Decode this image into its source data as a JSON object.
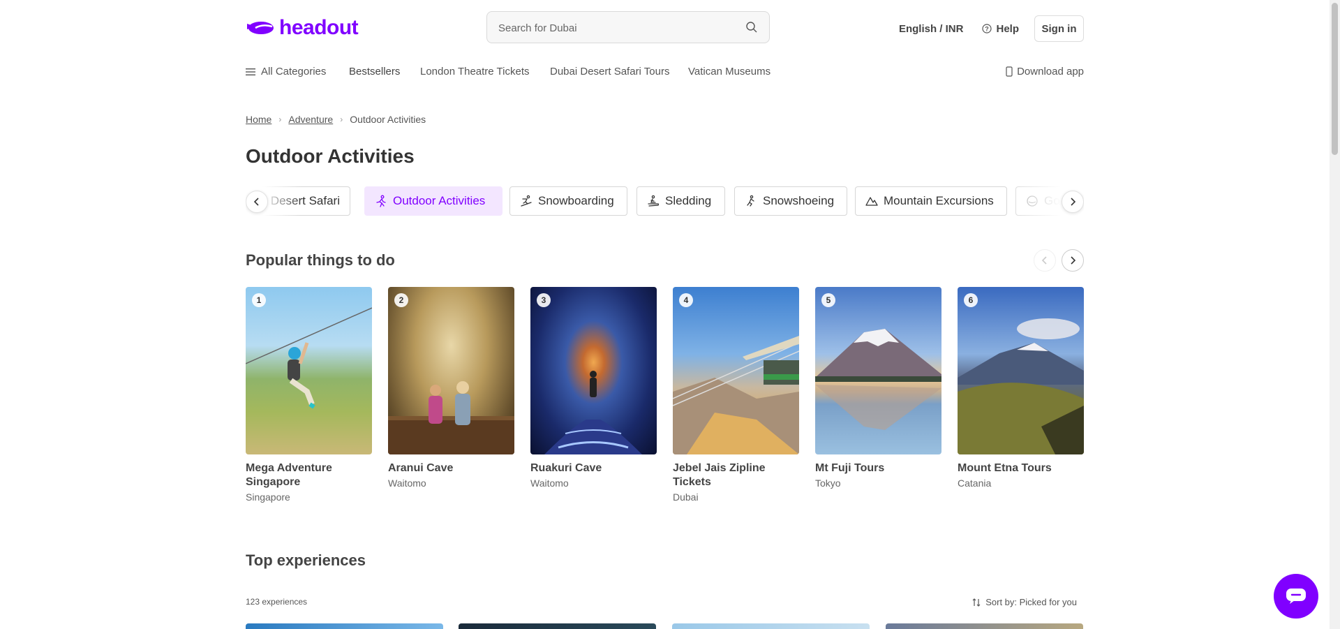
{
  "header": {
    "logo_text": "headout",
    "search_placeholder": "Search for Dubai",
    "language_currency": "English / INR",
    "help_label": "Help",
    "signin_label": "Sign in"
  },
  "nav": {
    "all_categories": "All Categories",
    "items": [
      "Bestsellers",
      "London Theatre Tickets",
      "Dubai Desert Safari Tours",
      "Vatican Museums"
    ],
    "download_app": "Download app"
  },
  "breadcrumb": [
    "Home",
    "Adventure",
    "Outdoor Activities"
  ],
  "page_title": "Outdoor Activities",
  "categories": [
    {
      "label": "Desert Safari",
      "icon": "desert-icon",
      "state": "partial"
    },
    {
      "label": "Outdoor Activities",
      "icon": "hiking-icon",
      "state": "active"
    },
    {
      "label": "Snowboarding",
      "icon": "snowboarding-icon",
      "state": "normal"
    },
    {
      "label": "Sledding",
      "icon": "sledding-icon",
      "state": "normal"
    },
    {
      "label": "Snowshoeing",
      "icon": "snowshoeing-icon",
      "state": "normal"
    },
    {
      "label": "Mountain Excursions",
      "icon": "mountain-icon",
      "state": "normal"
    },
    {
      "label": "Go",
      "icon": "golf-icon",
      "state": "partial"
    }
  ],
  "popular": {
    "title": "Popular things to do",
    "items": [
      {
        "rank": "1",
        "name": "Mega Adventure Singapore",
        "city": "Singapore"
      },
      {
        "rank": "2",
        "name": "Aranui Cave",
        "city": "Waitomo"
      },
      {
        "rank": "3",
        "name": "Ruakuri Cave",
        "city": "Waitomo"
      },
      {
        "rank": "4",
        "name": "Jebel Jais Zipline Tickets",
        "city": "Dubai"
      },
      {
        "rank": "5",
        "name": "Mt Fuji Tours",
        "city": "Tokyo"
      },
      {
        "rank": "6",
        "name": "Mount Etna Tours",
        "city": "Catania"
      }
    ]
  },
  "top_experiences": {
    "title": "Top experiences",
    "count": "123 experiences",
    "sort": "Sort by: Picked for you"
  },
  "colors": {
    "brand": "#8000ff",
    "active_chip_bg": "#f3e6ff"
  }
}
